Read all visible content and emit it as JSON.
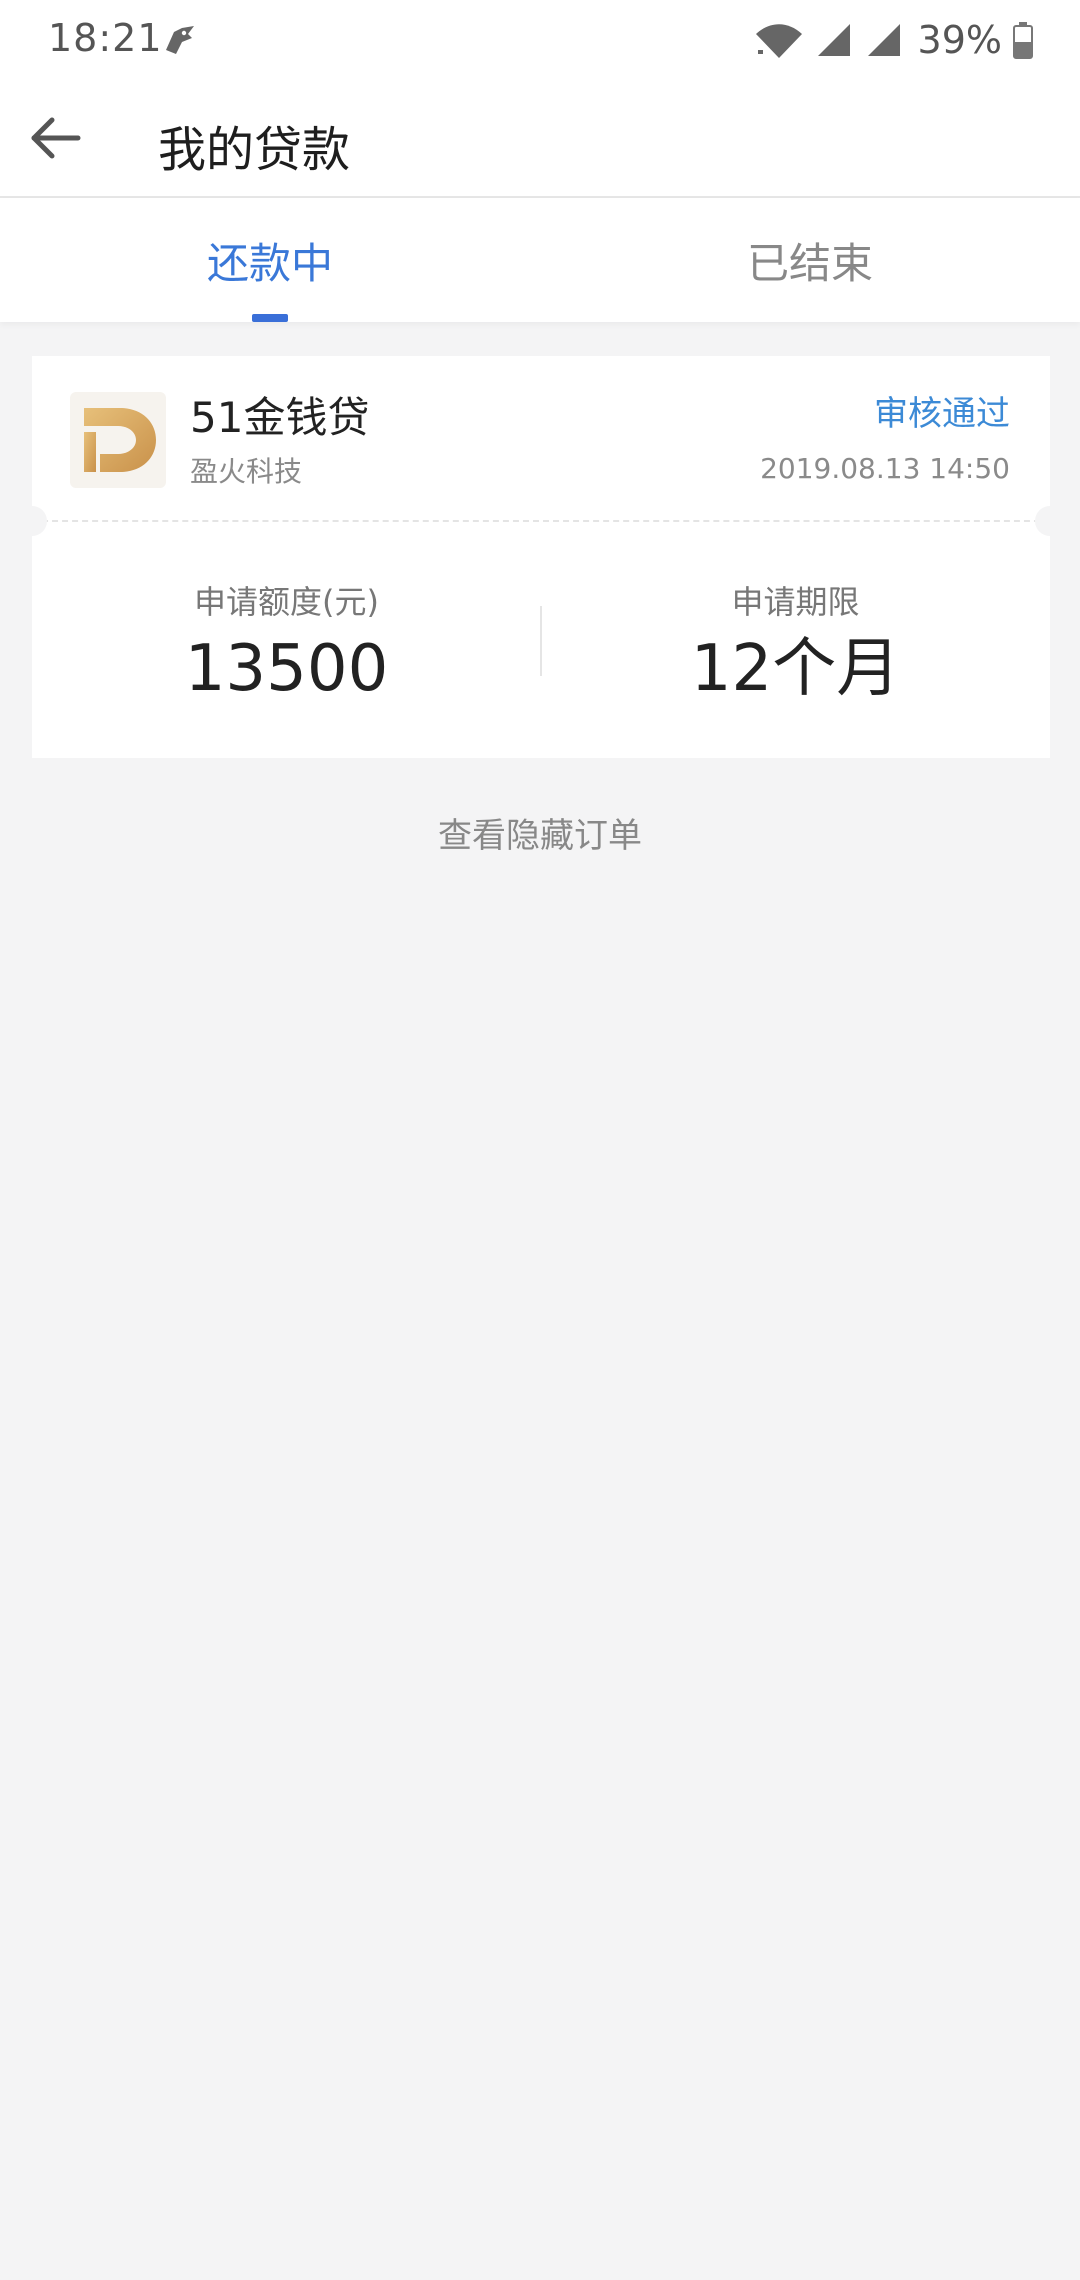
{
  "status_bar": {
    "time": "18:21",
    "battery_percent": "39%",
    "icons": [
      "app-notification-icon",
      "wifi-icon",
      "signal-icon",
      "signal-icon",
      "battery-icon"
    ]
  },
  "header": {
    "title": "我的贷款",
    "back_icon": "arrow-left-icon"
  },
  "tabs": [
    {
      "label": "还款中",
      "active": true
    },
    {
      "label": "已结束",
      "active": false
    }
  ],
  "colors": {
    "accent": "#3a78d8",
    "status_blue": "#3c8ad6",
    "background": "#f4f4f5",
    "logo_gold": "#d6a553"
  },
  "loan": {
    "product_name": "51金钱贷",
    "company": "盈火科技",
    "status": "审核通过",
    "datetime": "2019.08.13 14:50",
    "amount_label": "申请额度(元)",
    "amount_value": "13500",
    "term_label": "申请期限",
    "term_value": "12个月"
  },
  "footer_link": "查看隐藏订单"
}
